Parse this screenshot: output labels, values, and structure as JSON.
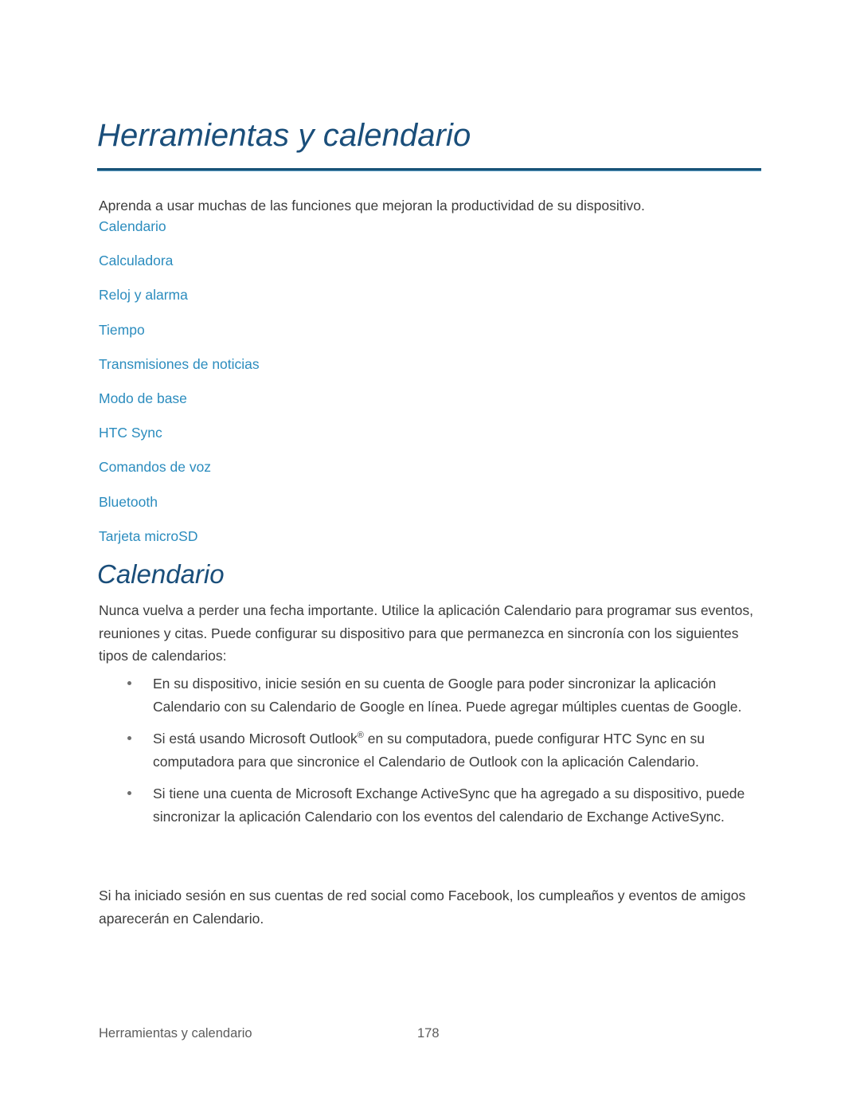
{
  "document": {
    "title": "Herramientas y calendario",
    "intro": "Aprenda a usar muchas de las funciones que mejoran la productividad de su dispositivo."
  },
  "toc": {
    "items": [
      {
        "label": "Calendario"
      },
      {
        "label": "Calculadora"
      },
      {
        "label": "Reloj y alarma"
      },
      {
        "label": "Tiempo"
      },
      {
        "label": "Transmisiones de noticias"
      },
      {
        "label": "Modo de base"
      },
      {
        "label": "HTC Sync"
      },
      {
        "label": "Comandos de voz"
      },
      {
        "label": "Bluetooth"
      },
      {
        "label": "Tarjeta microSD"
      }
    ]
  },
  "section": {
    "heading": "Calendario",
    "paragraph_1": "Nunca vuelva a perder una fecha importante. Utilice la aplicación Calendario para programar sus eventos, reuniones y citas. Puede configurar su dispositivo para que permanezca en sincronía con los siguientes tipos de calendarios:",
    "bullets": [
      {
        "text_before": "En su dispositivo, inicie sesión en su cuenta de Google para poder sincronizar la aplicación Calendario con su Calendario de Google en línea. Puede agregar múltiples cuentas de Google.",
        "superscript": "",
        "text_after": ""
      },
      {
        "text_before": "Si está usando Microsoft Outlook",
        "superscript": "®",
        "text_after": " en su computadora, puede configurar HTC Sync en su computadora para que sincronice el Calendario de Outlook con la aplicación Calendario."
      },
      {
        "text_before": "Si tiene una cuenta de Microsoft Exchange ActiveSync que ha agregado a su dispositivo, puede sincronizar la aplicación Calendario con los eventos del calendario de Exchange ActiveSync.",
        "superscript": "",
        "text_after": ""
      }
    ],
    "paragraph_2": "Si ha iniciado sesión en sus cuentas de red social como Facebook, los cumpleaños y eventos de amigos aparecerán en Calendario."
  },
  "footer": {
    "chapter": "Herramientas y calendario",
    "page_number": "178"
  },
  "colors": {
    "heading_navy": "#1a4e7a",
    "link_blue": "#2b8cbe",
    "body_gray": "#3c3c3c",
    "footer_gray": "#5d5d5d",
    "rule_navy": "#185277",
    "page_background": "#ffffff"
  }
}
